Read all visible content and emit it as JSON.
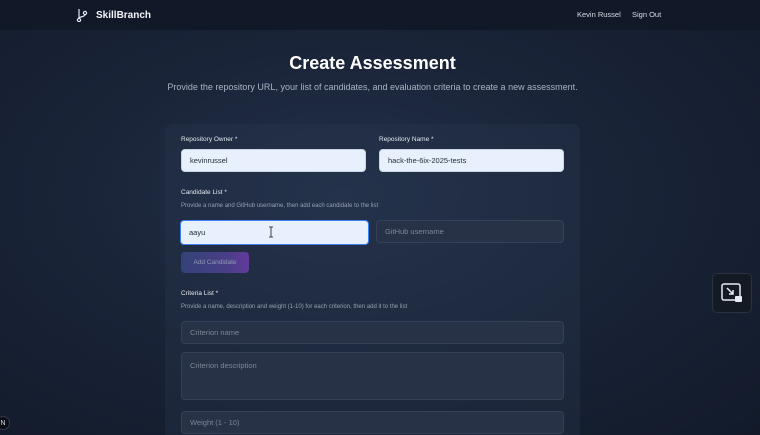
{
  "header": {
    "brand": "SkillBranch",
    "user_name": "Kevin Russel",
    "sign_out": "Sign Out"
  },
  "page": {
    "title": "Create Assessment",
    "subtitle": "Provide the repository URL, your list of candidates, and evaluation criteria to create a new assessment."
  },
  "form": {
    "repo_owner_label": "Repository Owner *",
    "repo_owner_value": "kevinrussel",
    "repo_name_label": "Repository Name *",
    "repo_name_value": "hack-the-6ix-2025-tests",
    "candidate_label": "Candidate List *",
    "candidate_help": "Provide a name and GitHub username, then add each candidate to the list",
    "candidate_name_value": "aayu",
    "github_placeholder": "GitHub username",
    "add_candidate": "Add Candidate",
    "criteria_label": "Criteria List *",
    "criteria_help": "Provide a name, description and weight (1-10) for each criterion, then add it to the list",
    "criterion_name_placeholder": "Criterion name",
    "criterion_desc_placeholder": "Criterion description",
    "weight_placeholder": "Weight (1 - 10)"
  },
  "icons": {
    "brand_icon": "git-branch-icon",
    "side_widget_icon": "picture-in-picture-icon",
    "corner_badge_icon": "n-badge-icon"
  },
  "colors": {
    "accent": "#3b82f6",
    "button_gradient_start": "#3b4a8a",
    "button_gradient_end": "#7a3fb8"
  }
}
